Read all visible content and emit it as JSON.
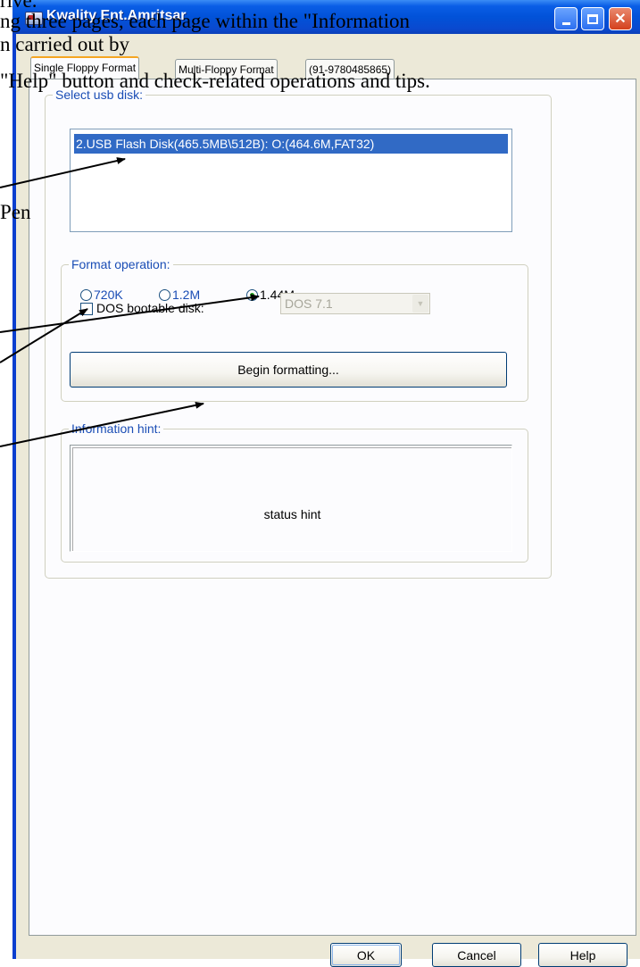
{
  "document_text": {
    "line1": "rive.",
    "line2": "ng three pages, each page within the \"Information",
    "line3": "n carried out by",
    "line4": "\"Help\" button and check-related operations and tips.",
    "line5": "Pen"
  },
  "window": {
    "title": "Kwality Ent.Amritsar",
    "controls": [
      "minimize",
      "maximize",
      "close"
    ]
  },
  "tabs": [
    {
      "label": "Single Floppy Format",
      "active": true
    },
    {
      "label": "Multi-Floppy Format",
      "active": false
    },
    {
      "label": "(91-9780485865)",
      "active": false
    }
  ],
  "select_disk": {
    "legend": "Select usb disk:",
    "items": [
      "2.USB Flash Disk(465.5MB\\512B): O:(464.6M,FAT32)"
    ],
    "selected_index": 0
  },
  "format_operation": {
    "legend": "Format operation:",
    "options": [
      "720K",
      "1.2M",
      "1.44M"
    ],
    "selected": "1.44M",
    "dos_bootable_label": "DOS bootable disk:",
    "dos_bootable_checked": false,
    "dos_version": "DOS 7.1",
    "begin_button": "Begin formatting..."
  },
  "information_hint": {
    "legend": "Information hint:",
    "text": "status hint"
  },
  "footer": {
    "ok": "OK",
    "cancel": "Cancel",
    "help": "Help"
  },
  "colors": {
    "titlebar": "#0152d8",
    "dialog_bg": "#ece9d8",
    "selection": "#316ac5",
    "legend_text": "#1a4db5"
  }
}
